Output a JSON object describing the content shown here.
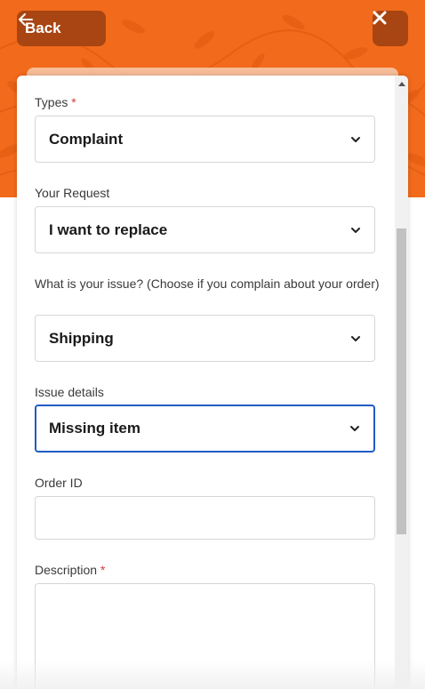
{
  "header": {
    "back_label": "Back",
    "accent_color": "#f26a1b",
    "button_color": "#a84512"
  },
  "form": {
    "types": {
      "label": "Types",
      "required": "*",
      "value": "Complaint"
    },
    "request": {
      "label": "Your Request",
      "value": "I want to replace"
    },
    "issue": {
      "label": "What is your issue? (Choose if you complain about your order)",
      "value": "Shipping"
    },
    "issue_details": {
      "label": "Issue details",
      "value": "Missing item"
    },
    "order_id": {
      "label": "Order ID",
      "value": ""
    },
    "description": {
      "label": "Description",
      "required": "*",
      "value": ""
    }
  },
  "icons": [
    "arrow-left-icon",
    "close-icon",
    "chevron-down-icon",
    "scroll-up-arrow-icon"
  ]
}
